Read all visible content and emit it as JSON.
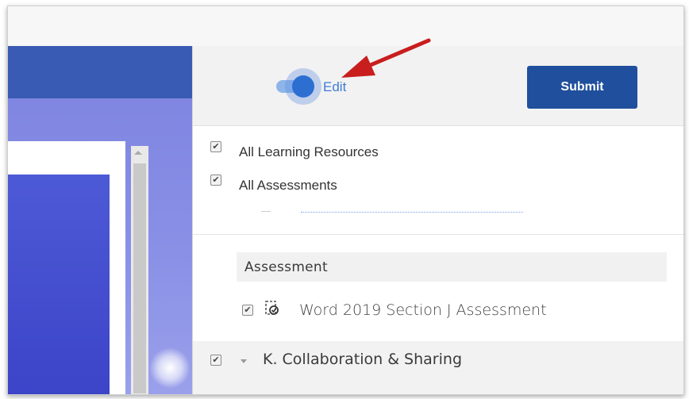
{
  "toolbar": {
    "toggle_label": "Edit",
    "toggle_on": true,
    "submit_label": "Submit"
  },
  "filters": [
    {
      "label": "All Learning Resources",
      "checked": true
    },
    {
      "label": "All Assessments",
      "checked": true
    }
  ],
  "section": {
    "title": "Assessment",
    "items": [
      {
        "label": "Word 2019 Section J Assessment",
        "checked": true,
        "icon": "assessment-doc-icon"
      }
    ]
  },
  "collapsed_group": {
    "label": "K. Collaboration & Sharing",
    "checked": true
  },
  "colors": {
    "accent": "#2c6fd1",
    "submit": "#1f4f9d",
    "annotation_arrow": "#c81e1e",
    "left_header": "#3a5bb3"
  }
}
